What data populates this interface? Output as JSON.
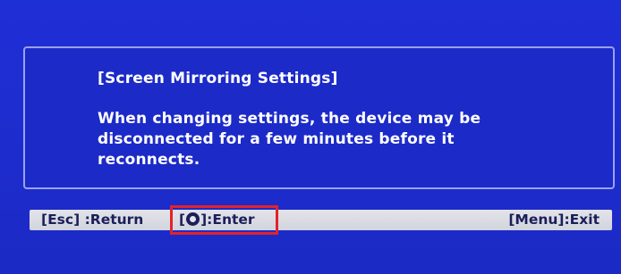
{
  "dialog": {
    "title": "[Screen Mirroring Settings]",
    "message_lines": [
      "When changing settings, the device may be",
      "disconnected for a few minutes before it",
      "reconnects."
    ]
  },
  "footer": {
    "esc_label": "[Esc] :Return",
    "enter_prefix": "[",
    "enter_suffix": "]:Enter",
    "menu_label": "[Menu]:Exit"
  },
  "icons": {
    "enter_icon": "enter-button-icon"
  },
  "colors": {
    "background": "#1f2fd6",
    "dialog_border": "#9aa2f0",
    "footer_bar": "#e3e4ea",
    "footer_text": "#1a1f5a",
    "highlight": "#e2232a"
  }
}
